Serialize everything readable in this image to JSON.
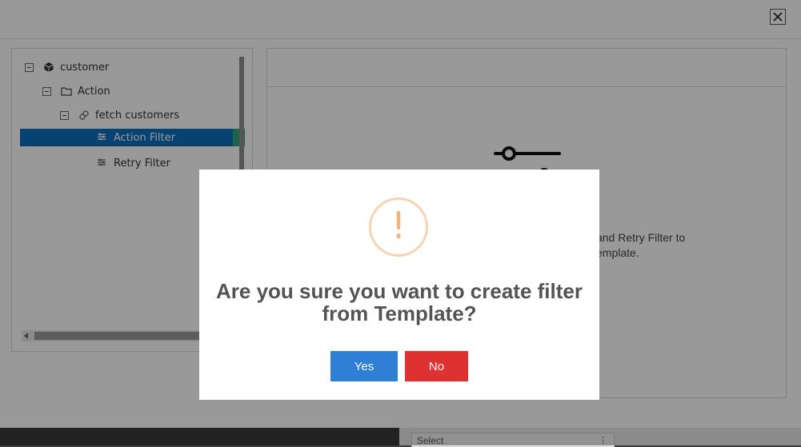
{
  "tree": {
    "items": [
      {
        "label": "customer",
        "icon": "cube-icon",
        "level": 0,
        "selected": false,
        "expanded": true
      },
      {
        "label": "Action",
        "icon": "folder-icon",
        "level": 1,
        "selected": false,
        "expanded": true
      },
      {
        "label": "fetch customers",
        "icon": "link-icon",
        "level": 2,
        "selected": false,
        "expanded": true
      },
      {
        "label": "Action Filter",
        "icon": "sliders-icon",
        "level": 3,
        "selected": true
      },
      {
        "label": "Retry Filter",
        "icon": "sliders-icon",
        "level": 3,
        "selected": false
      }
    ]
  },
  "right_panel": {
    "empty_line1": "and Retry Filter to",
    "empty_line2": "emplate."
  },
  "dialog": {
    "icon_mark": "!",
    "title_line1": "Are you sure you want to create filter",
    "title_line2": "from Template?",
    "yes_label": "Yes",
    "no_label": "No"
  },
  "background_page": {
    "select_value": "Select"
  },
  "colors": {
    "selected_row": "#0a6fbf",
    "yes_button": "#2f7fd6",
    "no_button": "#de3232",
    "warning": "#f6b477"
  }
}
